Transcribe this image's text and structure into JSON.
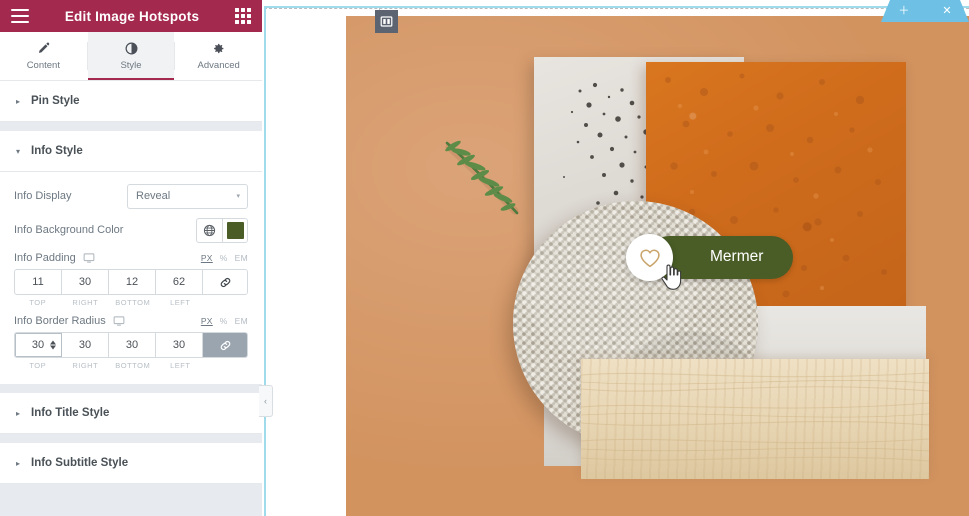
{
  "panel": {
    "header": {
      "title": "Edit Image Hotspots",
      "menu_icon": "hamburger-icon",
      "apps_icon": "apps-grid-icon"
    },
    "tabs": [
      {
        "label": "Content",
        "icon": "pencil-icon",
        "active": false
      },
      {
        "label": "Style",
        "icon": "contrast-circle-icon",
        "active": true
      },
      {
        "label": "Advanced",
        "icon": "gear-icon",
        "active": false
      }
    ],
    "sections": [
      {
        "label": "Pin Style",
        "expanded": false,
        "caret": "▸"
      },
      {
        "label": "Info Style",
        "expanded": true,
        "caret": "▾"
      },
      {
        "label": "Info Title Style",
        "expanded": false,
        "caret": "▸"
      },
      {
        "label": "Info Subtitle Style",
        "expanded": false,
        "caret": "▸"
      }
    ],
    "info_style": {
      "display": {
        "label": "Info Display",
        "value": "Reveal",
        "arrow": "▾"
      },
      "background_color": {
        "label": "Info Background Color",
        "globe_icon": "globe-icon",
        "swatch_hex": "#4a5d26"
      },
      "padding": {
        "label": "Info Padding",
        "device_icon": "desktop-icon",
        "units": [
          "PX",
          "%",
          "EM"
        ],
        "active_unit": "PX",
        "values": [
          "11",
          "30",
          "12",
          "62"
        ],
        "sides": [
          "TOP",
          "RIGHT",
          "BOTTOM",
          "LEFT"
        ],
        "link_icon": "link-icon",
        "linked": false
      },
      "border_radius": {
        "label": "Info Border Radius",
        "device_icon": "desktop-icon",
        "units": [
          "PX",
          "%",
          "EM"
        ],
        "active_unit": "PX",
        "values": [
          "30",
          "30",
          "30",
          "30"
        ],
        "sides": [
          "TOP",
          "RIGHT",
          "BOTTOM",
          "LEFT"
        ],
        "link_icon": "link-icon",
        "linked": true
      }
    },
    "collapse_tab": {
      "icon": "chevron-left-icon",
      "glyph": "‹"
    }
  },
  "canvas": {
    "widget_handle_icon": "columns-layout-icon",
    "section_toolbar": {
      "add_icon": "plus-icon",
      "add_glyph": "＋",
      "drag_icon": "drag-grid-icon",
      "close_icon": "close-x-icon",
      "close_glyph": "✕",
      "color_hex": "#6ec1e4"
    },
    "selection_outline_hex": "#9fdbea",
    "hotspot": {
      "pin_icon": "heart-icon",
      "pin_background_hex": "#ffffff",
      "pin_icon_hex": "#c9a46b",
      "info_label": "Mermer",
      "info_background_hex": "#4a5d26",
      "info_text_hex": "#ffffff",
      "cursor_icon": "pointing-hand-cursor"
    }
  }
}
